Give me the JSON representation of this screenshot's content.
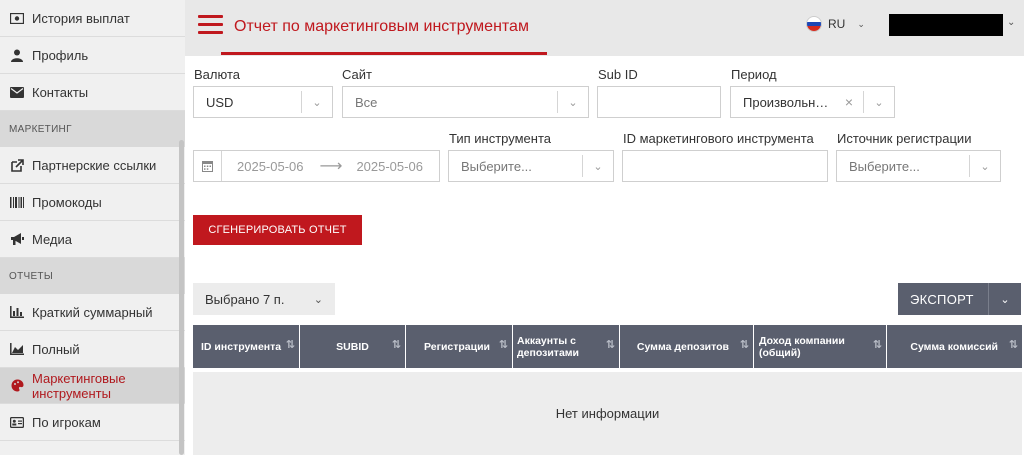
{
  "sidebar": {
    "items": [
      {
        "label": "История выплат",
        "icon": "money-icon"
      },
      {
        "label": "Профиль",
        "icon": "user-icon"
      },
      {
        "label": "Контакты",
        "icon": "envelope-icon"
      }
    ],
    "section_marketing": "МАРКЕТИНГ",
    "marketing_items": [
      {
        "label": "Партнерские ссылки",
        "icon": "external-link-icon"
      },
      {
        "label": "Промокоды",
        "icon": "barcode-icon"
      },
      {
        "label": "Медиа",
        "icon": "megaphone-icon"
      }
    ],
    "section_reports": "ОТЧЕТЫ",
    "report_items": [
      {
        "label": "Краткий суммарный",
        "icon": "bar-chart-icon"
      },
      {
        "label": "Полный",
        "icon": "area-chart-icon"
      },
      {
        "label": "Маркетинговые инструменты",
        "icon": "palette-icon",
        "active": true
      },
      {
        "label": "По игрокам",
        "icon": "id-card-icon"
      }
    ]
  },
  "header": {
    "title": "Отчет по маркетинговым инструментам",
    "lang": "RU"
  },
  "form": {
    "currency_label": "Валюта",
    "currency_value": "USD",
    "site_label": "Сайт",
    "site_value": "Все",
    "subid_label": "Sub ID",
    "subid_value": "",
    "period_label": "Период",
    "period_value": "Произвольн…",
    "date_from": "2025-05-06",
    "date_to": "2025-05-06",
    "tool_type_label": "Тип инструмента",
    "tool_type_placeholder": "Выберите...",
    "tool_id_label": "ID маркетингового инструмента",
    "tool_id_value": "",
    "reg_source_label": "Источник регистрации",
    "reg_source_placeholder": "Выберите...",
    "generate_button": "СГЕНЕРИРОВАТЬ ОТЧЕТ"
  },
  "toolbar": {
    "selected_label": "Выбрано 7 п.",
    "export_label": "ЭКСПОРТ"
  },
  "table": {
    "columns": [
      "ID инструмента",
      "SUBID",
      "Регистрации",
      "Аккаунты с депозитами",
      "Сумма депозитов",
      "Доход компании (общий)",
      "Сумма комиссий"
    ],
    "empty_text": "Нет информации"
  },
  "colors": {
    "accent": "#c0181e",
    "header_bg": "#5a5f6e"
  }
}
